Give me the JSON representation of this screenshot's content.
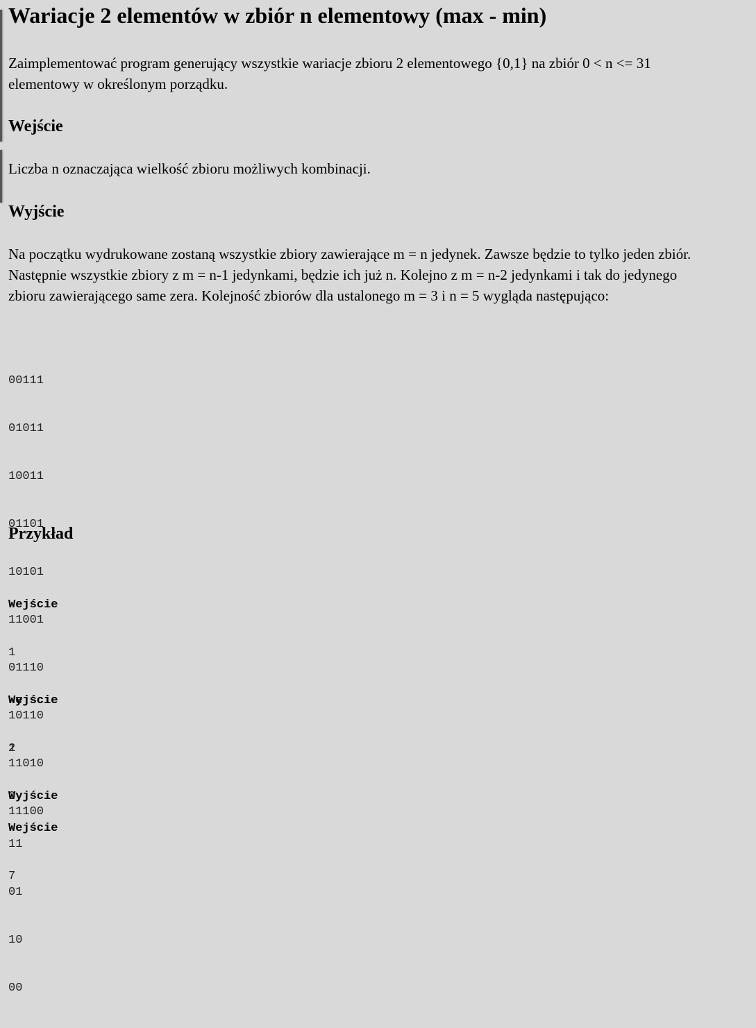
{
  "title": "Wariacje 2 elementów w zbiór n elementowy (max - min)",
  "intro": "Zaimplementować program generujący wszystkie wariacje zbioru 2 elementowego {0,1} na zbiór 0 < n <= 31 elementowy w określonym porządku.",
  "input_section": {
    "heading": "Wejście",
    "text": "Liczba n oznaczająca wielkość zbioru możliwych kombinacji."
  },
  "output_section": {
    "heading": "Wyjście",
    "text": "Na początku wydrukowane zostaną wszystkie zbiory zawierające m = n jedynek. Zawsze będzie to tylko jeden zbiór. Następnie wszystkie zbiory z m = n-1 jedynkami, będzie ich już n. Kolejno z m = n-2 jedynkami i tak do jedynego zbioru zawierającego same zera. Kolejność zbiorów dla ustalonego m = 3 i n = 5 wygląda następująco:",
    "listing": [
      "00111",
      "01011",
      "10011",
      "01101",
      "10101",
      "11001",
      "01110",
      "10110",
      "11010",
      "11100"
    ]
  },
  "example_section": {
    "heading": "Przykład",
    "examples": [
      {
        "input_label": "Wejście",
        "input": [
          "1"
        ],
        "output_label": "Wyjście",
        "output": [
          "1",
          "0"
        ]
      },
      {
        "input_label": "Wejście",
        "input": [
          "2"
        ],
        "output_label": "Wyjście",
        "output": [
          "11",
          "01",
          "10",
          "00"
        ]
      },
      {
        "input_label": "Wejście",
        "input": [
          "7"
        ]
      }
    ]
  }
}
